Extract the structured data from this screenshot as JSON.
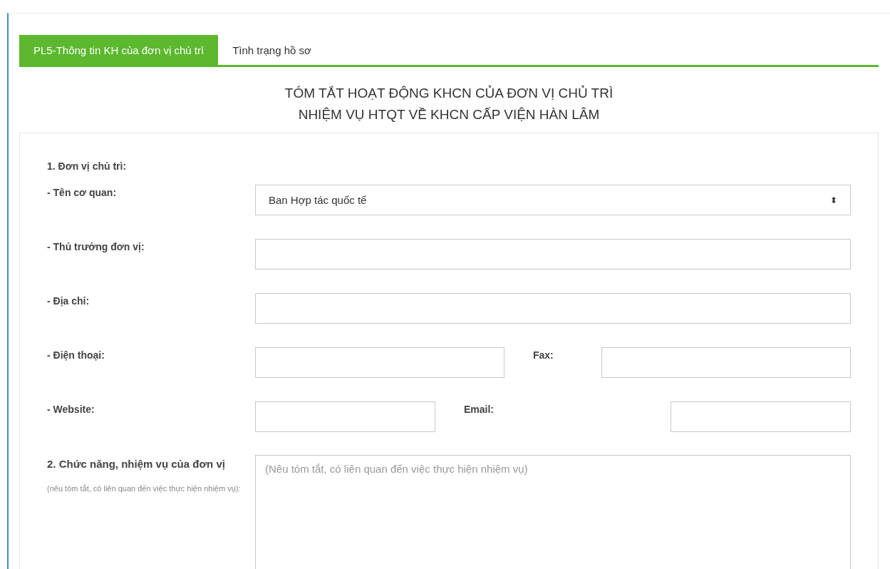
{
  "tabs": [
    {
      "label": "PL5-Thông tin KH của đơn vị chủ trì",
      "selected": true
    },
    {
      "label": "Tình trạng hồ sơ",
      "selected": false
    }
  ],
  "title_lines": [
    "TÓM TẮT HOẠT ĐỘNG KHCN CỦA ĐƠN VỊ CHỦ TRÌ",
    "NHIỆM VỤ HTQT VỀ KHCN CẤP VIỆN HÀN LÂM"
  ],
  "section_1": {
    "heading": "1. Đơn vị chủ trì:",
    "fields": [
      {
        "label": "- Tên cơ quan:",
        "kind": "select",
        "value": "Ban Hợp tác quốc tế",
        "caret": "⬍"
      },
      {
        "label": "- Thủ trưởng đơn vị:",
        "kind": "text"
      },
      {
        "label": "- Địa chỉ:",
        "kind": "text"
      }
    ],
    "phone_row": {
      "label": "- Điện thoại:",
      "second_label": "Fax:"
    },
    "web_row": {
      "label": "- Website:",
      "second_label": "Email:"
    }
  },
  "section_2": {
    "heading": "2. Chức năng, nhiệm vụ của đơn vị",
    "note": "(nêu tóm tắt, có liên quan đến việc thực hiện nhiệm vụ):",
    "placeholder": "(Nêu tóm tắt, có liên quan đến việc thực hiện nhiệm vụ)"
  }
}
